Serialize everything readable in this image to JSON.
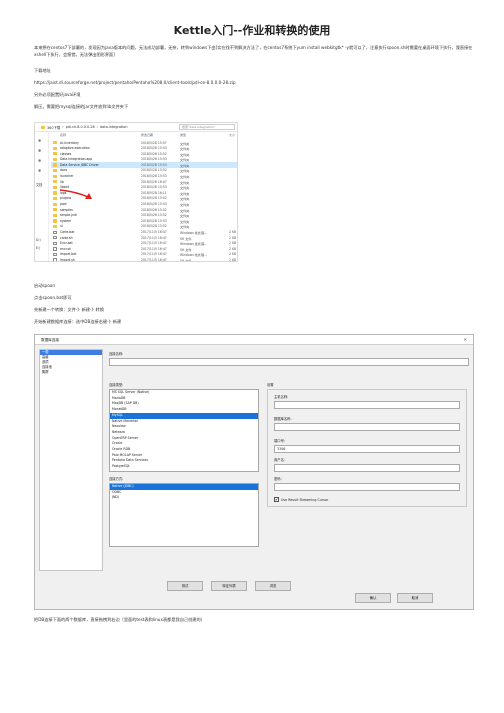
{
  "title": "Kettle入门--作业和转换的使用",
  "intro": "本来想在centos7下部署的，发现因为java版本的问题，无法成功部署，无奈，转到windows下由[实在找不到解决方法了，在centos7系统下yum install webkitgtk* -y就可以了，注意执行spoon.sh时需要在桌面环境下执行，我直接在xshell下执行，会报错，无法弹出图形界面]",
  "download_label": "下载地址",
  "download_url": "https://jaist.dl.sourceforge.net/project/pentaho/Pentaho%208.0/client-tools/pdi-ce-8.0.0.0-28.zip",
  "java_note": "另外必须配置好java环境",
  "unzip_note": "解压，需要把mysql连接的jar文件放到lib文件夹下",
  "explorer": {
    "breadcrumb": [
      "360下载",
      "pdi-ce-8.0.0.0-28",
      "data-integration"
    ],
    "search_placeholder": "搜索\"data-integration\"",
    "columns": [
      "名称",
      "修改日期",
      "类型",
      "大小"
    ],
    "side_labels": [
      "文档",
      "D:)",
      "E:)"
    ],
    "rows": [
      {
        "name": "Ar.Inventory",
        "date": "2018/5/28 15:57",
        "type": "文件夹",
        "size": "",
        "kind": "folder"
      },
      {
        "name": "adaptive-execution",
        "date": "2018/5/28 15:53",
        "type": "文件夹",
        "size": "",
        "kind": "folder"
      },
      {
        "name": "classes",
        "date": "2018/5/28 15:52",
        "type": "文件夹",
        "size": "",
        "kind": "folder"
      },
      {
        "name": "Data Integration.app",
        "date": "2018/5/28 15:53",
        "type": "文件夹",
        "size": "",
        "kind": "folder"
      },
      {
        "name": "Data Service JDBC Driver",
        "date": "2018/5/28 15:53",
        "type": "文件夹",
        "size": "",
        "kind": "folder",
        "selected": true
      },
      {
        "name": "docs",
        "date": "2018/5/28 15:52",
        "type": "文件夹",
        "size": "",
        "kind": "folder"
      },
      {
        "name": "launcher",
        "date": "2018/5/28 15:53",
        "type": "文件夹",
        "size": "",
        "kind": "folder"
      },
      {
        "name": "lib",
        "date": "2018/5/28 16:07",
        "type": "文件夹",
        "size": "",
        "kind": "folder"
      },
      {
        "name": "libswt",
        "date": "2018/5/28 15:53",
        "type": "文件夹",
        "size": "",
        "kind": "folder"
      },
      {
        "name": "logs",
        "date": "2018/5/28 16:11",
        "type": "文件夹",
        "size": "",
        "kind": "folder"
      },
      {
        "name": "plugins",
        "date": "2018/5/28 15:52",
        "type": "文件夹",
        "size": "",
        "kind": "folder"
      },
      {
        "name": "pwd",
        "date": "2018/5/28 15:53",
        "type": "文件夹",
        "size": "",
        "kind": "folder"
      },
      {
        "name": "samples",
        "date": "2018/5/28 15:52",
        "type": "文件夹",
        "size": "",
        "kind": "folder"
      },
      {
        "name": "simple-jndi",
        "date": "2018/5/28 15:52",
        "type": "文件夹",
        "size": "",
        "kind": "folder"
      },
      {
        "name": "system",
        "date": "2018/5/28 15:53",
        "type": "文件夹",
        "size": "",
        "kind": "folder"
      },
      {
        "name": "ui",
        "date": "2018/5/28 15:52",
        "type": "文件夹",
        "size": "",
        "kind": "folder"
      },
      {
        "name": "Carte.bat",
        "date": "2017/11/5 16:47",
        "type": "Windows 批处理...",
        "size": "2 KB",
        "kind": "file"
      },
      {
        "name": "carte.sh",
        "date": "2017/11/5 16:47",
        "type": "SH 文件",
        "size": "2 KB",
        "kind": "file"
      },
      {
        "name": "Encr.bat",
        "date": "2017/11/5 16:47",
        "type": "Windows 批处理...",
        "size": "2 KB",
        "kind": "file"
      },
      {
        "name": "encr.sh",
        "date": "2017/11/5 16:47",
        "type": "SH 文件",
        "size": "2 KB",
        "kind": "file"
      },
      {
        "name": "Import.bat",
        "date": "2017/11/5 16:47",
        "type": "Windows 批处理...",
        "size": "2 KB",
        "kind": "file"
      },
      {
        "name": "import.sh",
        "date": "2017/11/5 16:47",
        "type": "SH 文件",
        "size": "2 KB",
        "kind": "file"
      },
      {
        "name": "import-rules.xml",
        "date": "2017/11/5 16:47",
        "type": "XML 文档",
        "size": "2 KB",
        "kind": "file"
      },
      {
        "name": "Kitchen.bat",
        "date": "2017/11/5 16:47",
        "type": "Windows 批处理...",
        "size": "2 KB",
        "kind": "file"
      }
    ]
  },
  "start_spoon": "启动spoon",
  "click_spoon": "点击spoon.bat即可",
  "create_trans": "先新建一个转换：文件-》新建-》转换",
  "open_conn": "开始新建数据库连接：选中DB连接右键-》新建",
  "dialog": {
    "title": "数据库连接",
    "close": "✕",
    "left_items": [
      "一般",
      "高级",
      "选项",
      "连接池",
      "集群"
    ],
    "left_selected": 0,
    "conn_name_label": "连接名称:",
    "conn_type_label": "连接类型:",
    "conn_types": [
      "MS SQL Server (Native)",
      "MariaDB",
      "MaxDB (SAP DB)",
      "MonetDB",
      "MySQL",
      "Native Mondrian",
      "Neoview",
      "Netezza",
      "OpenERP Server",
      "Oracle",
      "Oracle RDB",
      "Palo MOLAP Server",
      "Pentaho Data Services",
      "PostgreSQL"
    ],
    "conn_type_selected": 4,
    "access_label": "连接方式:",
    "access_types": [
      "Native (JDBC)",
      "ODBC",
      "JNDI"
    ],
    "access_selected": 0,
    "settings_label": "设置",
    "host_label": "主机名称:",
    "db_label": "数据库名称:",
    "port_label": "端口号:",
    "port_value": "3306",
    "user_label": "用户名:",
    "password_label": "密码:",
    "streaming_label": "Use Result Streaming Cursor",
    "test_btn": "测试",
    "features_btn": "特征列表",
    "explore_btn": "浏览",
    "ok_btn": "确认",
    "cancel_btn": "取消"
  },
  "footer_note": "把DB连接下面的两个数据库，直接拖拽到右边（里面的test表和linux表都是我自己创建的）"
}
